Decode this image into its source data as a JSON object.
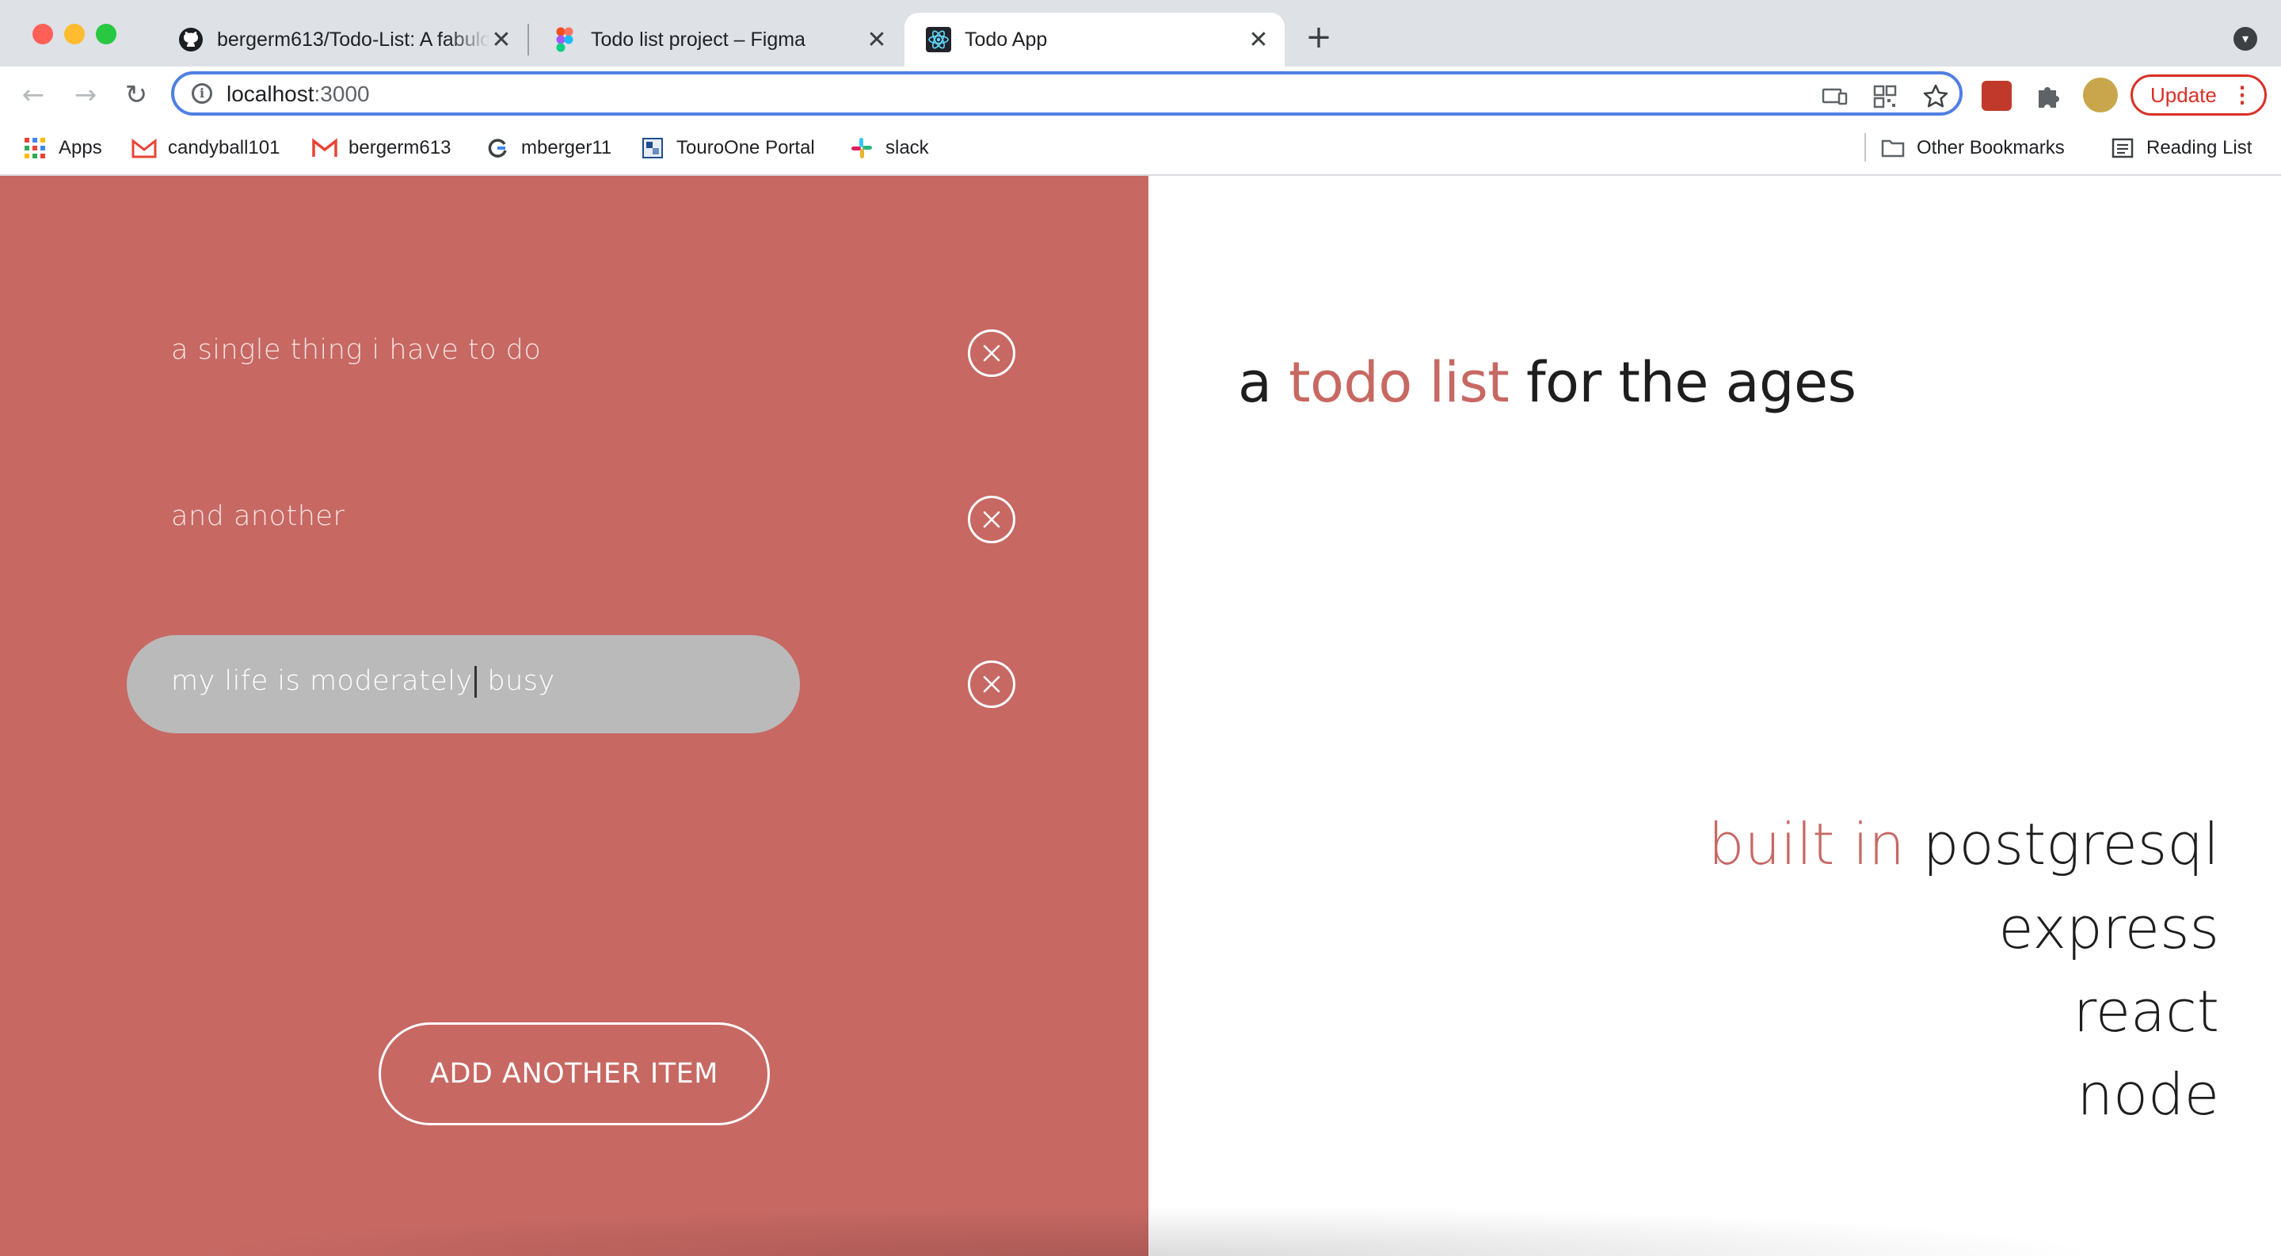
{
  "browser": {
    "tabs": [
      {
        "title": "bergerm613/Todo-List: A fabulous todo list",
        "active": false,
        "favicon": "github-icon"
      },
      {
        "title": "Todo list project – Figma",
        "active": false,
        "favicon": "figma-icon"
      },
      {
        "title": "Todo App",
        "active": true,
        "favicon": "react-icon"
      }
    ],
    "new_tab": "+",
    "close_glyph": "✕",
    "address": {
      "host": "localhost",
      "port": ":3000"
    },
    "update_label": "Update",
    "bookmarks": [
      {
        "label": "Apps",
        "icon": "apps-grid-icon"
      },
      {
        "label": "candyball101",
        "icon": "gmail-icon"
      },
      {
        "label": "bergerm613",
        "icon": "gmail-icon"
      },
      {
        "label": "mberger11",
        "icon": "google-icon"
      },
      {
        "label": "TouroOne Portal",
        "icon": "touro-icon"
      },
      {
        "label": "slack",
        "icon": "slack-icon"
      }
    ],
    "other_bookmarks": "Other Bookmarks",
    "reading_list": "Reading List"
  },
  "todo": {
    "items": [
      {
        "text": "a single thing i have to do",
        "editing": false
      },
      {
        "text": "and another",
        "editing": false
      },
      {
        "text_before_cursor": "my life is moderately",
        "text_after_cursor": " busy",
        "editing": true
      }
    ],
    "add_button_label": "ADD ANOTHER ITEM"
  },
  "hero": {
    "prefix": "a ",
    "accent": "todo list",
    "suffix": " for the ages"
  },
  "stack": {
    "accent": "built in ",
    "items": [
      "postgresql",
      "express",
      "react",
      "node"
    ]
  },
  "colors": {
    "accent": "#c76863",
    "panel": "#c76863",
    "editing_field": "#bababa",
    "text_dark": "#1e1e1e"
  }
}
